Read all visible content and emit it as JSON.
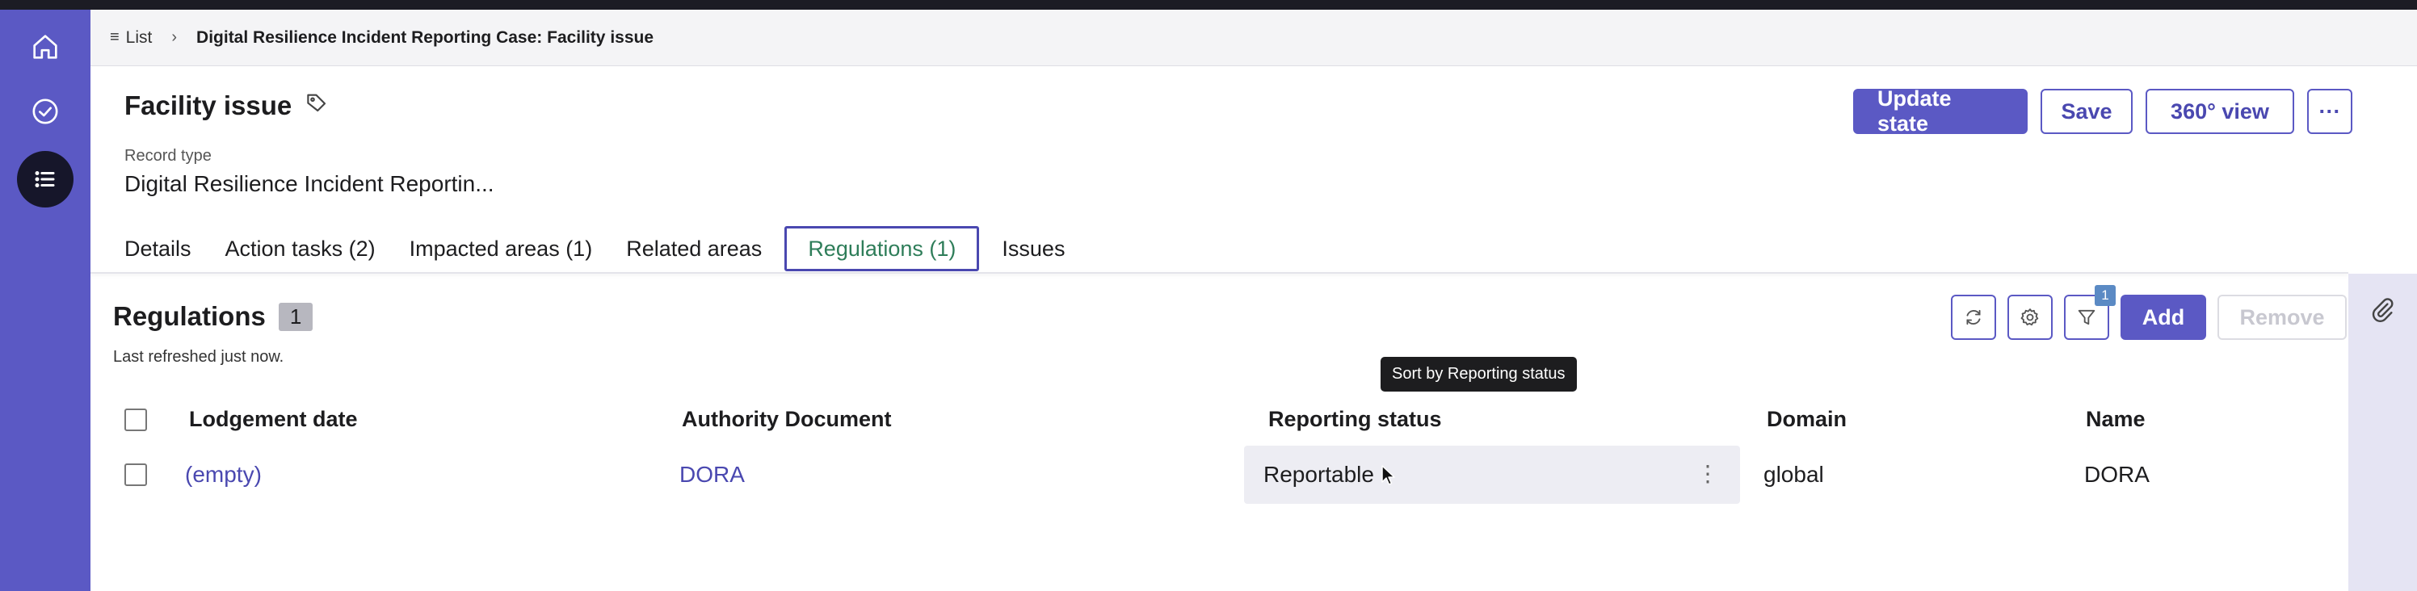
{
  "breadcrumb": {
    "list_label": "List",
    "current": "Digital Resilience Incident Reporting Case: Facility issue"
  },
  "record": {
    "title": "Facility issue",
    "record_type_label": "Record type",
    "record_type_value": "Digital Resilience Incident Reportin..."
  },
  "actions": {
    "update_state": "Update state",
    "save": "Save",
    "view_360": "360° view",
    "more": "···"
  },
  "tabs": [
    {
      "label": "Details"
    },
    {
      "label": "Action tasks (2)"
    },
    {
      "label": "Impacted areas (1)"
    },
    {
      "label": "Related areas"
    },
    {
      "label": "Regulations (1)",
      "active": true
    },
    {
      "label": "Issues"
    }
  ],
  "regulations": {
    "title": "Regulations",
    "count": "1",
    "refreshed": "Last refreshed just now.",
    "filter_count": "1",
    "add_label": "Add",
    "remove_label": "Remove",
    "tooltip": "Sort by Reporting status",
    "columns": [
      "Lodgement date",
      "Authority Document",
      "Reporting status",
      "Domain",
      "Name"
    ],
    "rows": [
      {
        "lodgement_date": "(empty)",
        "authority_document": "DORA",
        "reporting_status": "Reportable",
        "domain": "global",
        "name": "DORA"
      }
    ]
  },
  "icons": {
    "rail": [
      "home-icon",
      "check-circle-icon",
      "list-icon"
    ],
    "title_tag": "tag-icon",
    "tools": [
      "refresh-icon",
      "gear-icon",
      "filter-icon"
    ],
    "attachment": "paperclip-icon"
  },
  "colors": {
    "brand": "#5b59c4",
    "active_tab_text": "#2e7d59",
    "link": "#4a48b0",
    "dark": "#1c1c24"
  }
}
